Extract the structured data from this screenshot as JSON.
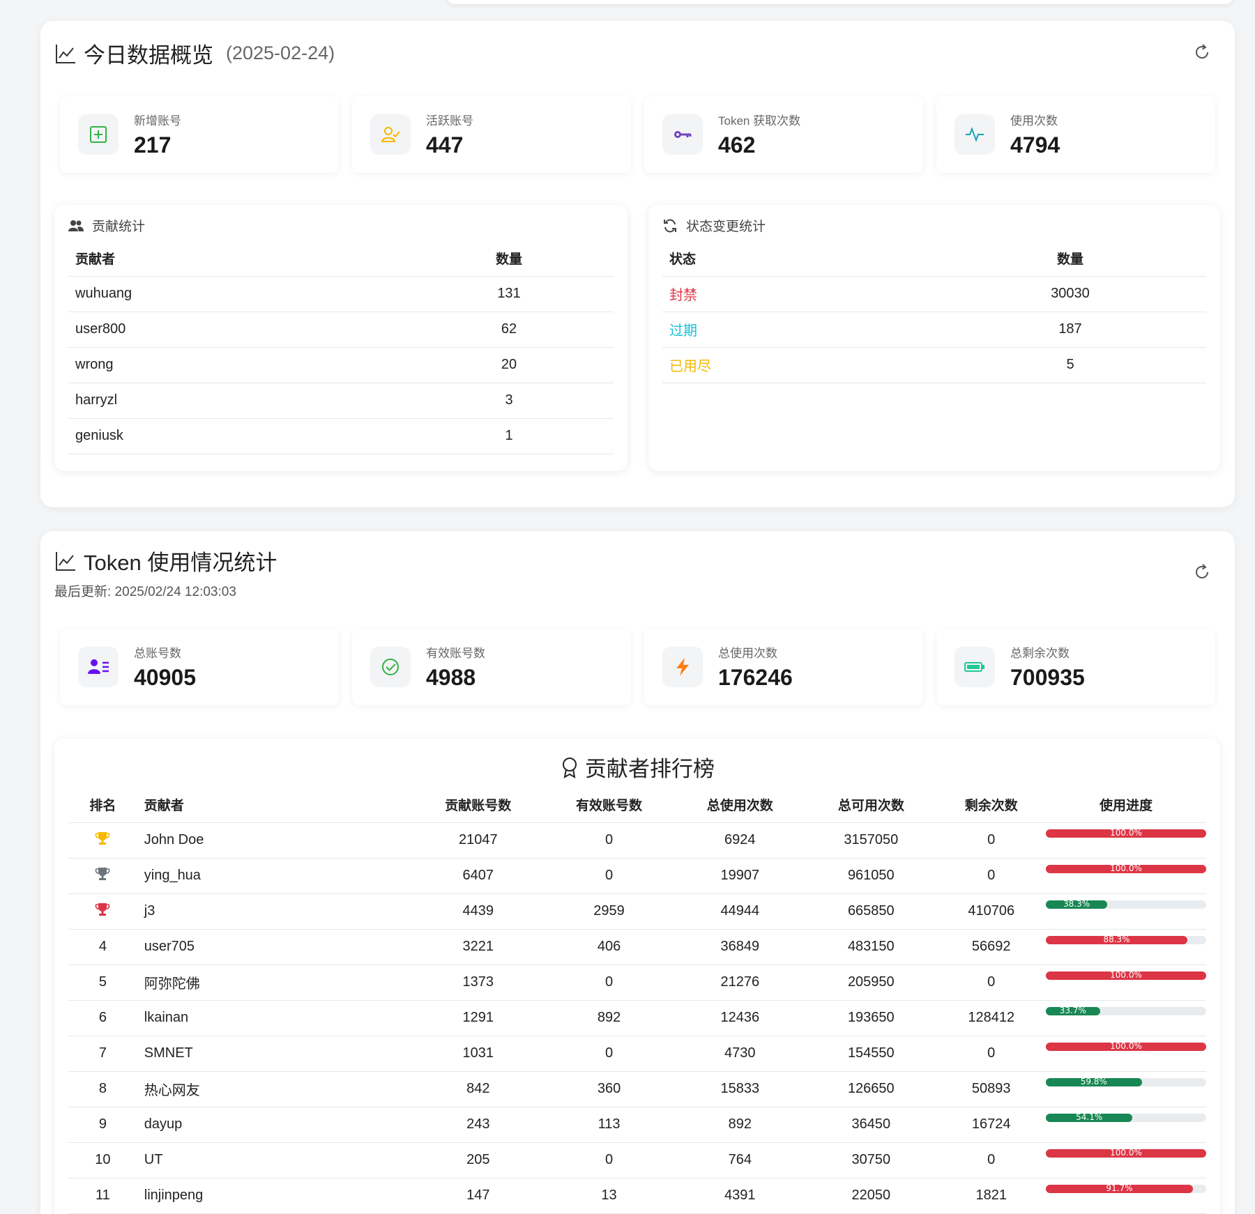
{
  "overview": {
    "title": "今日数据概览",
    "date": "(2025-02-24)",
    "stats": [
      {
        "label": "新增账号",
        "value": "217"
      },
      {
        "label": "活跃账号",
        "value": "447"
      },
      {
        "label": "Token 获取次数",
        "value": "462"
      },
      {
        "label": "使用次数",
        "value": "4794"
      }
    ],
    "contrib": {
      "title": "贡献统计",
      "headers": [
        "贡献者",
        "数量"
      ],
      "rows": [
        {
          "name": "wuhuang",
          "count": "131"
        },
        {
          "name": "user800",
          "count": "62"
        },
        {
          "name": "wrong",
          "count": "20"
        },
        {
          "name": "harryzl",
          "count": "3"
        },
        {
          "name": "geniusk",
          "count": "1"
        }
      ]
    },
    "status": {
      "title": "状态变更统计",
      "headers": [
        "状态",
        "数量"
      ],
      "rows": [
        {
          "name": "封禁",
          "count": "30030",
          "color": "#dc3545"
        },
        {
          "name": "过期",
          "count": "187",
          "color": "#17c1d9"
        },
        {
          "name": "已用尽",
          "count": "5",
          "color": "#f5b800"
        }
      ]
    }
  },
  "token": {
    "title": "Token 使用情况统计",
    "updated": "最后更新: 2025/02/24 12:03:03",
    "stats": [
      {
        "label": "总账号数",
        "value": "40905"
      },
      {
        "label": "有效账号数",
        "value": "4988"
      },
      {
        "label": "总使用次数",
        "value": "176246"
      },
      {
        "label": "总剩余次数",
        "value": "700935"
      }
    ],
    "ranking": {
      "title": "贡献者排行榜",
      "headers": [
        "排名",
        "贡献者",
        "贡献账号数",
        "有效账号数",
        "总使用次数",
        "总可用次数",
        "剩余次数",
        "使用进度"
      ],
      "rows": [
        {
          "rank": "",
          "trophy": "#f5b800",
          "name": "John Doe",
          "accounts": "21047",
          "valid": "0",
          "used": "6924",
          "available": "3157050",
          "remaining": "0",
          "progress": 100.0,
          "progress_text": "100.0%"
        },
        {
          "rank": "",
          "trophy": "#6c757d",
          "name": "ying_hua",
          "accounts": "6407",
          "valid": "0",
          "used": "19907",
          "available": "961050",
          "remaining": "0",
          "progress": 100.0,
          "progress_text": "100.0%"
        },
        {
          "rank": "",
          "trophy": "#dc3545",
          "name": "j3",
          "accounts": "4439",
          "valid": "2959",
          "used": "44944",
          "available": "665850",
          "remaining": "410706",
          "progress": 38.3,
          "progress_text": "38.3%"
        },
        {
          "rank": "4",
          "name": "user705",
          "accounts": "3221",
          "valid": "406",
          "used": "36849",
          "available": "483150",
          "remaining": "56692",
          "progress": 88.3,
          "progress_text": "88.3%"
        },
        {
          "rank": "5",
          "name": "阿弥陀佛",
          "accounts": "1373",
          "valid": "0",
          "used": "21276",
          "available": "205950",
          "remaining": "0",
          "progress": 100.0,
          "progress_text": "100.0%"
        },
        {
          "rank": "6",
          "name": "lkainan",
          "accounts": "1291",
          "valid": "892",
          "used": "12436",
          "available": "193650",
          "remaining": "128412",
          "progress": 33.7,
          "progress_text": "33.7%"
        },
        {
          "rank": "7",
          "name": "SMNET",
          "accounts": "1031",
          "valid": "0",
          "used": "4730",
          "available": "154550",
          "remaining": "0",
          "progress": 100.0,
          "progress_text": "100.0%"
        },
        {
          "rank": "8",
          "name": "热心网友",
          "accounts": "842",
          "valid": "360",
          "used": "15833",
          "available": "126650",
          "remaining": "50893",
          "progress": 59.8,
          "progress_text": "59.8%"
        },
        {
          "rank": "9",
          "name": "dayup",
          "accounts": "243",
          "valid": "113",
          "used": "892",
          "available": "36450",
          "remaining": "16724",
          "progress": 54.1,
          "progress_text": "54.1%"
        },
        {
          "rank": "10",
          "name": "UT",
          "accounts": "205",
          "valid": "0",
          "used": "764",
          "available": "30750",
          "remaining": "0",
          "progress": 100.0,
          "progress_text": "100.0%"
        },
        {
          "rank": "11",
          "name": "linjinpeng",
          "accounts": "147",
          "valid": "13",
          "used": "4391",
          "available": "22050",
          "remaining": "1821",
          "progress": 91.7,
          "progress_text": "91.7%"
        }
      ]
    }
  },
  "colors": {
    "progress_high": "#dc3545",
    "progress_low": "#198754"
  }
}
